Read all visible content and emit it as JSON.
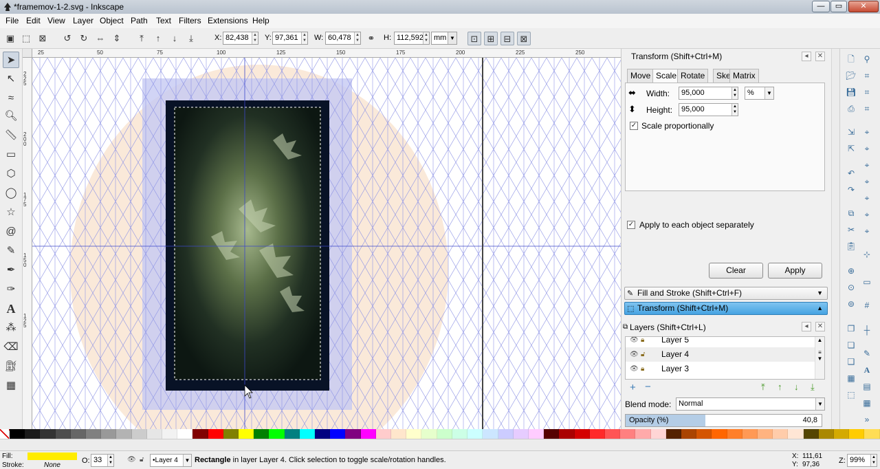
{
  "window": {
    "title": "*framemov-1-2.svg - Inkscape",
    "controls": {
      "minimize": "—",
      "maximize": "▭",
      "close": "✕"
    }
  },
  "menu": {
    "items": [
      "File",
      "Edit",
      "View",
      "Layer",
      "Object",
      "Path",
      "Text",
      "Filters",
      "Extensions",
      "Help"
    ]
  },
  "toolctl": {
    "x_label": "X:",
    "x_value": "82,438",
    "y_label": "Y:",
    "y_value": "97,361",
    "w_label": "W:",
    "w_value": "60,478",
    "h_label": "H:",
    "h_value": "112,592",
    "unit": "mm"
  },
  "rulers": {
    "h_labels": [
      "25",
      "50",
      "75",
      "100",
      "125",
      "150",
      "175",
      "200",
      "225",
      "250"
    ],
    "v_labels": [
      "225",
      "200",
      "175",
      "150",
      "125"
    ]
  },
  "transform": {
    "title": "Transform (Shift+Ctrl+M)",
    "tabs": [
      "Move",
      "Scale",
      "Rotate",
      "Skew",
      "Matrix"
    ],
    "active_tab": "Scale",
    "width_label": "Width:",
    "width_value": "95,000",
    "height_label": "Height:",
    "height_value": "95,000",
    "unit": "%",
    "scale_proportionally": "Scale proportionally",
    "apply_each": "Apply to each object separately",
    "clear": "Clear",
    "apply": "Apply"
  },
  "collapsed": {
    "fill_stroke": "Fill and Stroke (Shift+Ctrl+F)",
    "transform": "Transform (Shift+Ctrl+M)"
  },
  "layers": {
    "title": "Layers (Shift+Ctrl+L)",
    "rows": [
      "Layer 5",
      "Layer 4",
      "Layer 3"
    ],
    "blend_label": "Blend mode:",
    "blend_value": "Normal",
    "opacity_label": "Opacity (%)",
    "opacity_value": "40,8",
    "opacity_fraction": 0.408
  },
  "palette": {
    "colors": [
      "#000000",
      "#1a1a1a",
      "#333333",
      "#4d4d4d",
      "#666666",
      "#808080",
      "#999999",
      "#b3b3b3",
      "#cccccc",
      "#e6e6e6",
      "#f2f2f2",
      "#ffffff",
      "#800000",
      "#ff0000",
      "#808000",
      "#ffff00",
      "#008000",
      "#00ff00",
      "#008080",
      "#00ffff",
      "#000080",
      "#0000ff",
      "#800080",
      "#ff00ff",
      "#ffcccc",
      "#ffe6cc",
      "#ffffcc",
      "#e6ffcc",
      "#ccffcc",
      "#ccffe6",
      "#ccffff",
      "#cce6ff",
      "#ccccff",
      "#e6ccff",
      "#ffccff",
      "#550000",
      "#aa0000",
      "#d40000",
      "#ff2a2a",
      "#ff5555",
      "#ff8080",
      "#ffaaaa",
      "#ffd5d5",
      "#552200",
      "#aa4400",
      "#d45500",
      "#ff6600",
      "#ff7f2a",
      "#ff9955",
      "#ffb380",
      "#ffccaa",
      "#ffe6d5",
      "#554400",
      "#aa8800",
      "#d4aa00",
      "#ffcc00",
      "#ffdd55"
    ]
  },
  "status": {
    "fill_label": "Fill:",
    "stroke_label": "Stroke:",
    "stroke_value": "None",
    "opacity_label": "O:",
    "opacity_value": "33",
    "layer_value": "•Layer 4",
    "message_bold": "Rectangle",
    "message_rest": " in layer Layer 4. Click selection to toggle scale/rotation handles.",
    "x_label": "X:",
    "x_value": "111,61",
    "y_label": "Y:",
    "y_value": "97,36",
    "zoom_label": "Z:",
    "zoom_value": "99%"
  }
}
